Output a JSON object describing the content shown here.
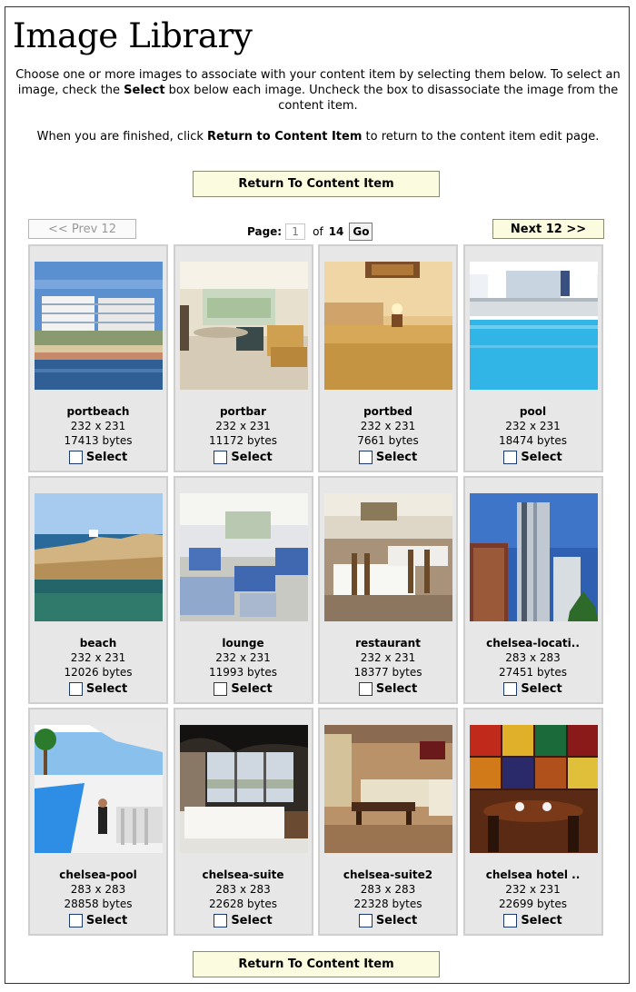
{
  "page": {
    "title": "Image Library",
    "intro_1_pre": "Choose one or more images to associate with your content item by selecting them below. To select an image, check the ",
    "intro_1_bold": "Select",
    "intro_1_post": " box below each image. Uncheck the box to disassociate the image from the content item.",
    "intro_2_pre": "When you are finished, click ",
    "intro_2_bold": "Return to Content Item",
    "intro_2_post": " to return to the content item edit page.",
    "return_label": "Return To Content Item"
  },
  "pager": {
    "prev_label": "<< Prev 12",
    "next_label": "Next 12 >>",
    "page_label": "Page:",
    "page_value": "1",
    "of_label": "of",
    "total_pages": "14",
    "go_label": "Go"
  },
  "select_label": "Select",
  "images": [
    {
      "name": "portbeach",
      "dims": "232 x 231",
      "size": "17413 bytes",
      "scene": "beach-hotel",
      "checked": false
    },
    {
      "name": "portbar",
      "dims": "232 x 231",
      "size": "11172 bytes",
      "scene": "bar",
      "checked": false
    },
    {
      "name": "portbed",
      "dims": "232 x 231",
      "size": "7661 bytes",
      "scene": "bedroom",
      "checked": false
    },
    {
      "name": "pool",
      "dims": "232 x 231",
      "size": "18474 bytes",
      "scene": "pool",
      "checked": false
    },
    {
      "name": "beach",
      "dims": "232 x 231",
      "size": "12026 bytes",
      "scene": "cliff",
      "checked": false
    },
    {
      "name": "lounge",
      "dims": "232 x 231",
      "size": "11993 bytes",
      "scene": "lounge",
      "checked": false
    },
    {
      "name": "restaurant",
      "dims": "232 x 231",
      "size": "18377 bytes",
      "scene": "restaurant",
      "checked": false
    },
    {
      "name": "chelsea-locati..",
      "dims": "283 x 283",
      "size": "27451 bytes",
      "scene": "tower",
      "checked": false
    },
    {
      "name": "chelsea-pool",
      "dims": "283 x 283",
      "size": "28858 bytes",
      "scene": "rooftop-pool",
      "checked": false
    },
    {
      "name": "chelsea-suite",
      "dims": "283 x 283",
      "size": "22628 bytes",
      "scene": "suite",
      "checked": false
    },
    {
      "name": "chelsea-suite2",
      "dims": "283 x 283",
      "size": "22328 bytes",
      "scene": "suite2",
      "checked": false
    },
    {
      "name": "chelsea hotel ..",
      "dims": "232 x 231",
      "size": "22699 bytes",
      "scene": "dining",
      "checked": false
    }
  ]
}
